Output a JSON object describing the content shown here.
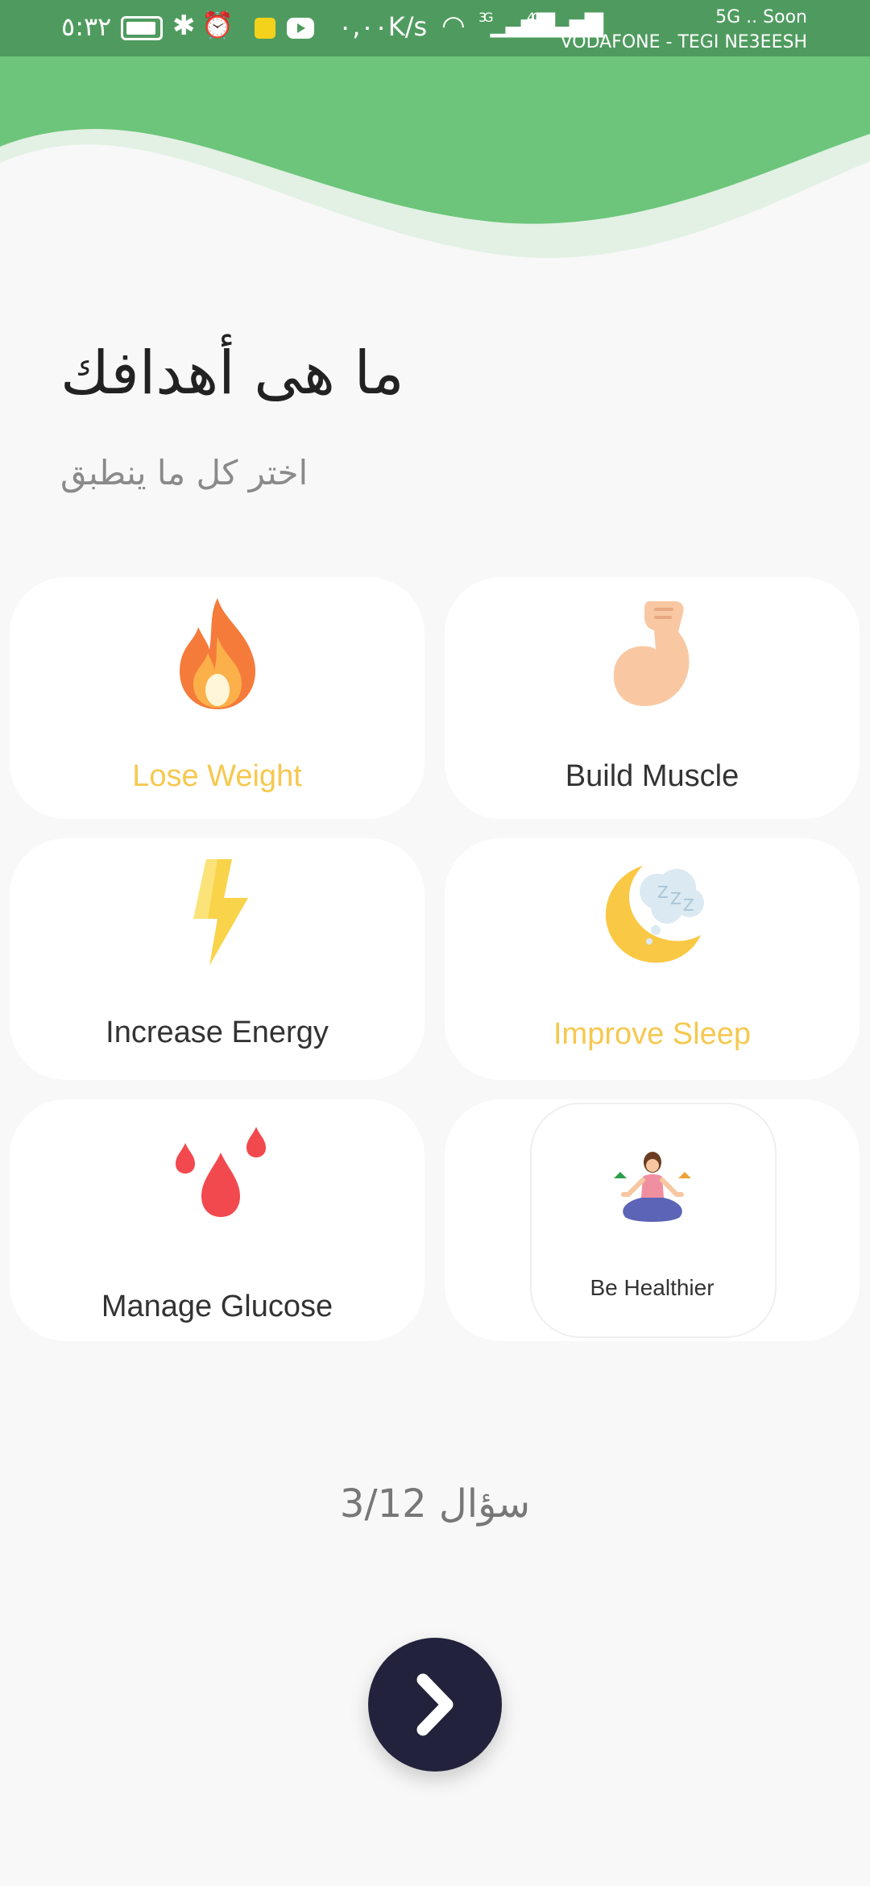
{
  "status_bar": {
    "time": "٥:٣٢",
    "network_speed": "٠,٠٠K/s",
    "signal_1_label": "3G",
    "signal_2_label": "4G",
    "network_line": "5G .. Soon",
    "carrier": "VODAFONE - TEGI NE3EESH",
    "icons": [
      "battery-icon",
      "bluetooth-icon",
      "alarm-icon",
      "app-notification-icon",
      "youtube-icon",
      "wifi-icon",
      "signal-icon"
    ]
  },
  "header": {
    "title": "ما هى أهدافك",
    "subtitle": "اختر كل ما ينطبق"
  },
  "goals": [
    {
      "label": "Lose Weight",
      "icon": "fire-icon",
      "selected": true
    },
    {
      "label": "Build Muscle",
      "icon": "flexed-arm-icon",
      "selected": false
    },
    {
      "label": "Increase Energy",
      "icon": "lightning-icon",
      "selected": false
    },
    {
      "label": "Improve Sleep",
      "icon": "moon-sleep-icon",
      "selected": true
    },
    {
      "label": "Manage Glucose",
      "icon": "blood-drops-icon",
      "selected": false
    },
    {
      "label": "Be Healthier",
      "icon": "yoga-woman-icon",
      "selected": false
    }
  ],
  "progress": {
    "text": "سؤال 3/12"
  },
  "next_button": {
    "icon": "chevron-right-icon"
  },
  "colors": {
    "status_bar": "#4f9b5f",
    "header_green": "#6cc57a",
    "header_light": "#e2f1e4",
    "selected_label": "#f6c84f",
    "button_dark": "#22223c"
  }
}
